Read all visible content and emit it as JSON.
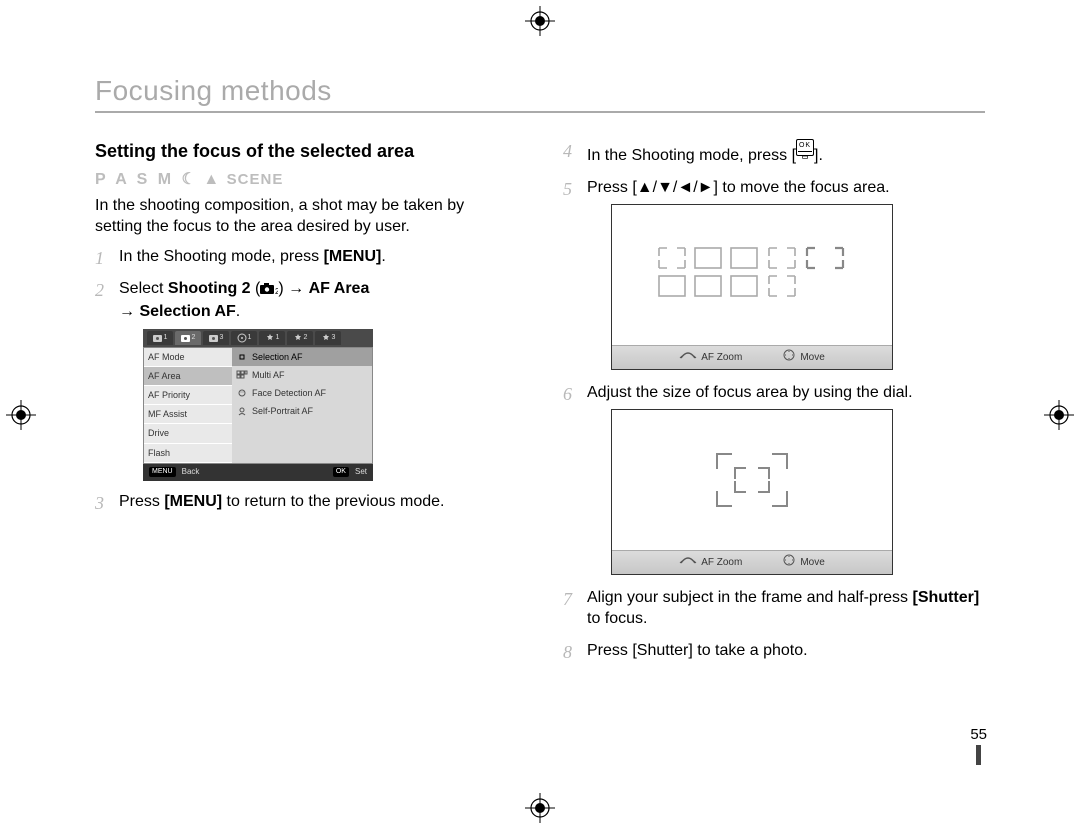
{
  "page_title": "Focusing methods",
  "page_number": "55",
  "left": {
    "section_title": "Setting the focus of the selected area",
    "mode_letters": "P A S M",
    "mode_scene": "SCENE",
    "intro": "In the shooting composition, a shot may be taken by setting the focus to the area desired by user.",
    "step1_a": "In the Shooting mode, press ",
    "step1_b": "[MENU]",
    "step1_c": ".",
    "step2_a": "Select ",
    "step2_b": "Shooting 2",
    "step2_c": " (",
    "step2_d": ") → ",
    "step2_e": "AF Area",
    "step2_f": " → ",
    "step2_g": "Selection AF",
    "step2_h": ".",
    "step3_a": "Press ",
    "step3_b": "[MENU]",
    "step3_c": " to return to the previous mode.",
    "menu": {
      "left_items": [
        "AF Mode",
        "AF Area",
        "AF Priority",
        "MF Assist",
        "Drive",
        "Flash"
      ],
      "right_items": [
        "Selection AF",
        "Multi AF",
        "Face Detection AF",
        "Self-Portrait AF"
      ],
      "foot_back_btn": "MENU",
      "foot_back": "Back",
      "foot_set_btn": "OK",
      "foot_set": "Set"
    }
  },
  "right": {
    "step4_a": "In the Shooting mode, press [",
    "step4_b": "].",
    "step5_a": "Press [",
    "step5_arrows": "▲/▼/◄/►",
    "step5_b": "] to move the focus area.",
    "step6": "Adjust the size of focus area by using the dial.",
    "step7_a": "Align your subject in the frame and half-press ",
    "step7_b": "[Shutter]",
    "step7_c": " to focus.",
    "step8": "Press [Shutter] to take a photo.",
    "screen_foot": {
      "afzoom": "AF Zoom",
      "move": "Move"
    }
  }
}
